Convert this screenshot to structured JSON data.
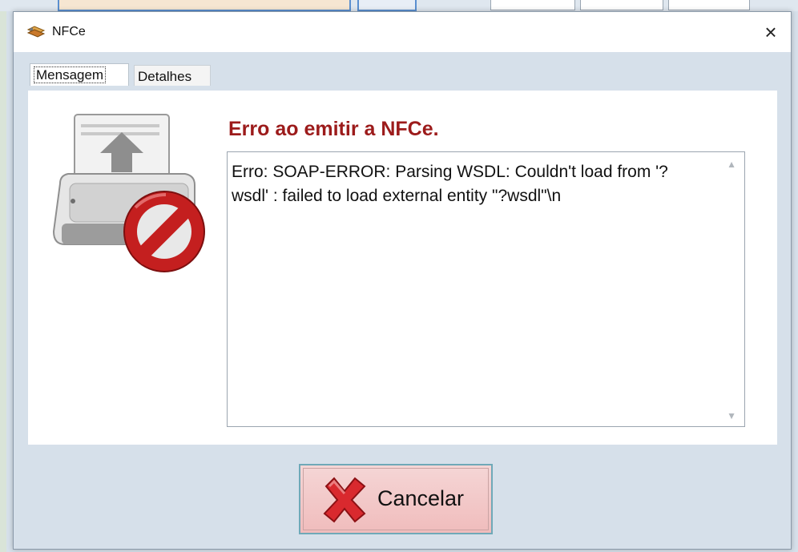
{
  "dialog": {
    "title": "NFCe",
    "close_symbol": "×",
    "title_icon": "app-icon"
  },
  "tabs": [
    {
      "label": "Mensagem",
      "active": true
    },
    {
      "label": "Detalhes",
      "active": false
    }
  ],
  "message": {
    "icon": "printer-error-icon",
    "heading": "Erro ao emitir a NFCe.",
    "body": "Erro: SOAP-ERROR: Parsing WSDL: Couldn't load from '?wsdl' : failed to load external entity \"?wsdl\"\\n"
  },
  "buttons": {
    "cancel_label": "Cancelar",
    "cancel_icon": "red-x-icon"
  },
  "colors": {
    "heading": "#9c1b1b",
    "dialog_bg": "#d6e0ea",
    "button_bg": "#f0bcbc"
  }
}
